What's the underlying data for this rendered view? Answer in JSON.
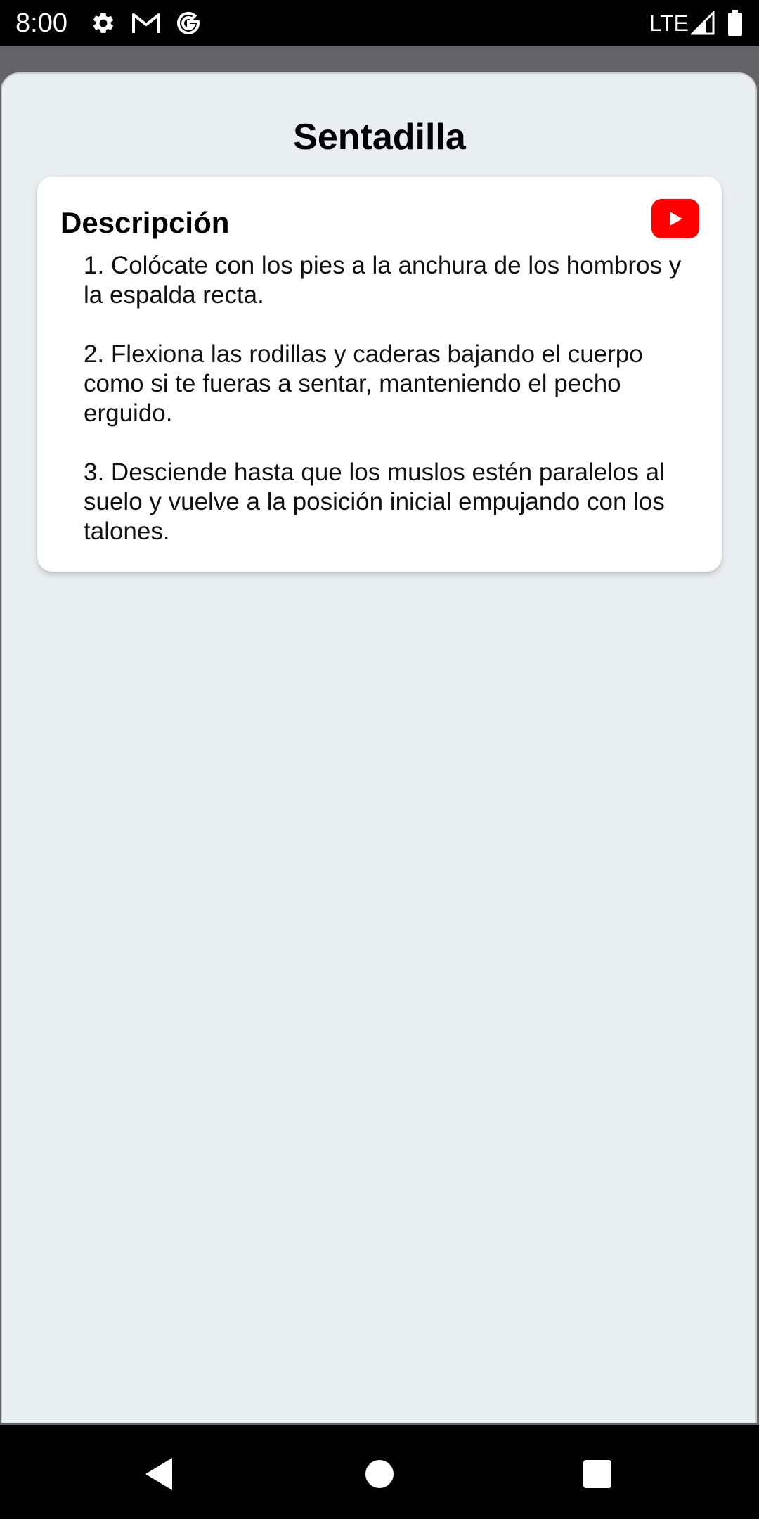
{
  "status_bar": {
    "time": "8:00",
    "network": "LTE",
    "icons": [
      "settings-icon",
      "gmail-icon",
      "google-icon",
      "signal-icon",
      "battery-icon"
    ]
  },
  "page": {
    "title": "Sentadilla"
  },
  "card": {
    "heading": "Descripción",
    "video_button_icon": "youtube-icon",
    "steps": [
      "1. Colócate con los pies a la anchura de los hombros y la espalda recta.",
      "2. Flexiona las rodillas y caderas bajando el cuerpo como si te fueras a sentar, manteniendo el pecho erguido.",
      "3. Desciende hasta que los muslos estén paralelos al suelo y vuelve a la posición inicial empujando con los talones."
    ]
  },
  "nav_bar": {
    "icons": [
      "back-icon",
      "home-icon",
      "recents-icon"
    ]
  },
  "colors": {
    "background": "#e9eef1",
    "card": "#ffffff",
    "youtube_red": "#ff0000",
    "bars": "#000000"
  }
}
